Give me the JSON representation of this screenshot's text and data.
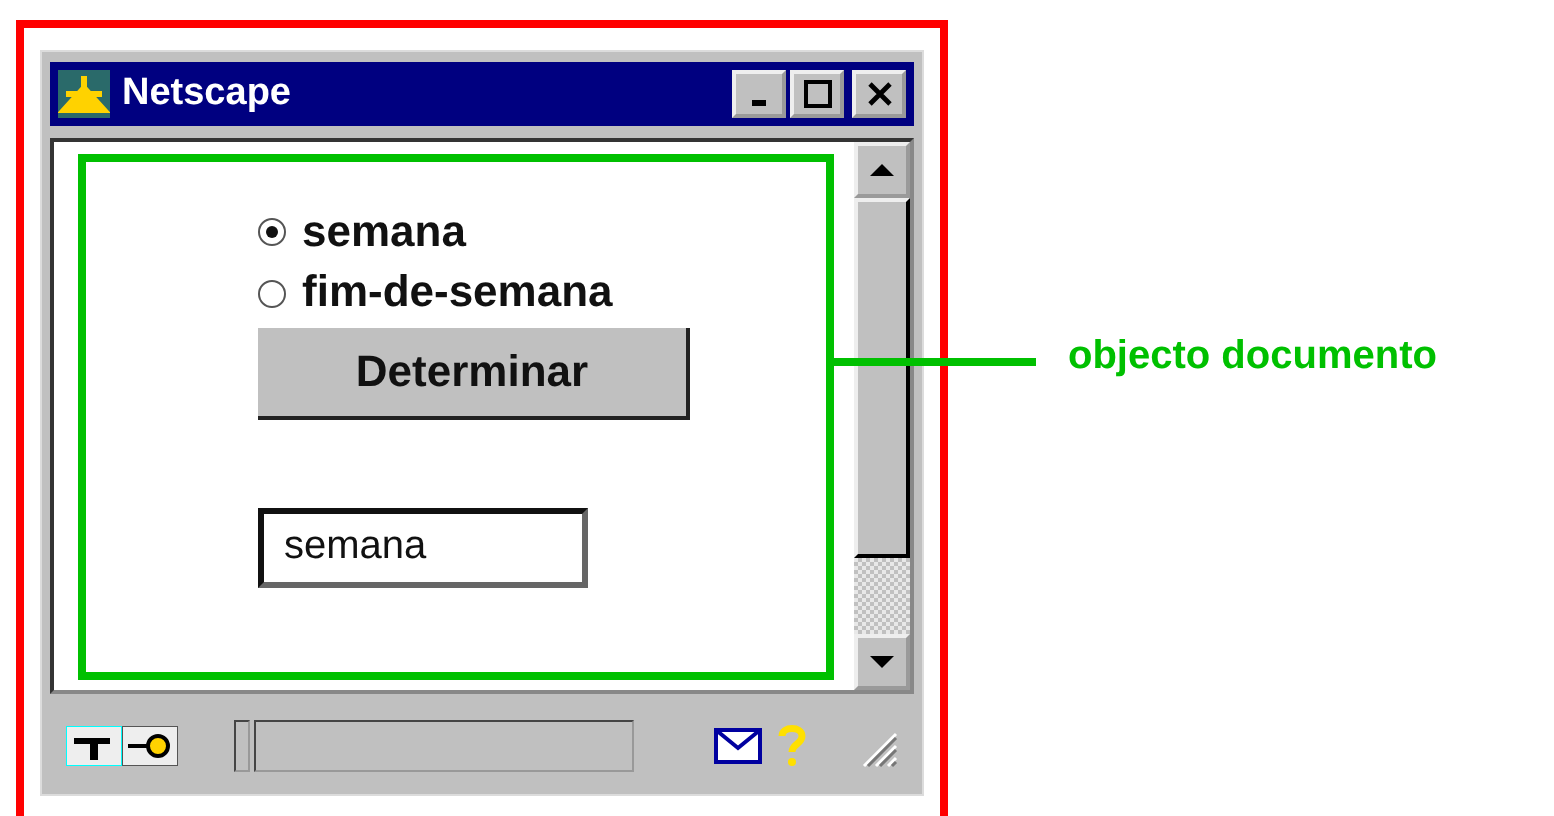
{
  "window": {
    "title": "Netscape"
  },
  "radios": [
    {
      "label": "semana",
      "selected": true
    },
    {
      "label": "fim-de-semana",
      "selected": false
    }
  ],
  "button": {
    "label": "Determinar"
  },
  "text_field": {
    "value": "semana"
  },
  "annotation": {
    "label": "objecto documento"
  }
}
